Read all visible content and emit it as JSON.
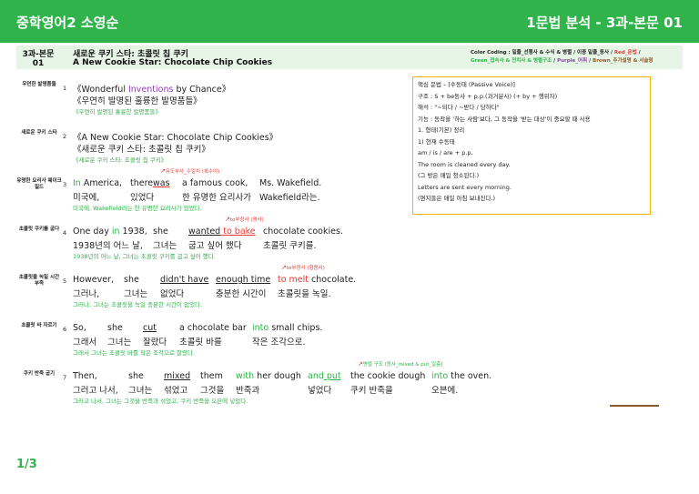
{
  "header": {
    "brand": "중학영어2 소영순",
    "unit": "1문법 분석 - 3과-본문 01"
  },
  "lesson": {
    "code_line1": "3과-본문",
    "code_line2": "01",
    "title_kr": "새로운 쿠키 스타: 초콜릿 칩 쿠키",
    "title_en": "A New Cookie Star: Chocolate Chip Cookies"
  },
  "color_coding": {
    "line1_a": "Color Coding : 밑줄_선행사 & 수식 & 병렬 / 이중 밑줄_동사 / ",
    "line1_red": "Red_문법",
    "line1_b": " /",
    "line2_green": "Green_접속사 & 전치사 & 병렬구조",
    "line2_sep1": " / ",
    "line2_purple": "Purple_어휘",
    "line2_sep2": " / ",
    "line2_brown": "Brown_추가설명 & 서술형"
  },
  "rows": [
    {
      "label": "우연한 발명품들",
      "num": "1",
      "en": "《Wonderful Inventions by Chance》",
      "en_a": "《Wonderful ",
      "en_purple": "Inventions",
      "en_b": " by Chance》",
      "ko": "《우연히 발명된 훌륭한 발명품들》",
      "tr": "《우연히 발명된 훌륭한 발명품들》"
    },
    {
      "label": "새로운 쿠키 스타",
      "num": "2",
      "en": "《A New Cookie Star: Chocolate Chip Cookies》",
      "ko": "《새로운 쿠키 스타: 초콜릿 칩 쿠키》",
      "tr": "《새로운 쿠키 스타: 초콜릿 칩 쿠키》"
    },
    {
      "label": "유명한 요리사 웨이크필드",
      "num": "3",
      "note": "유도부사_수일치 (복수이)",
      "en": [
        "In",
        " America,",
        "there",
        "was",
        "a famous cook,",
        "Ms. Wakefield."
      ],
      "ko": [
        "미국에,",
        "있었다",
        "한 유명한 요리사가",
        "Wakefield라는."
      ],
      "tr": "미국에, Wakefield라는 한 유명한 요리사가 있었다."
    },
    {
      "label": "초콜릿 쿠키를 굽다",
      "num": "4",
      "note": "to부정사 (명사)",
      "en": [
        "One day",
        " in",
        " 1938,",
        "she",
        "wanted",
        " to bake",
        "chocolate cookies."
      ],
      "ko": [
        "1938년의 어느 날,",
        "그녀는",
        "굽고 싶어 했다",
        "초콜릿 쿠키를."
      ],
      "tr": "1938년의 어느 날, 그녀는 초콜릿 쿠키를 굽고 싶어 했다."
    },
    {
      "label": "초콜릿을 녹일 시간 부족",
      "num": "5",
      "note": "to부정사 (형용사)",
      "en": [
        "However,",
        "she",
        "didn't have",
        "enough time",
        "to melt",
        " chocolate."
      ],
      "ko": [
        "그러나,",
        "그녀는",
        "없었다",
        "충분한 시간이",
        "초콜릿을 녹일."
      ],
      "tr": "그러나, 그녀는 초콜릿을 녹일 충분한 시간이 없었다."
    },
    {
      "label": "초콜릿 바 자르기",
      "num": "6",
      "en": [
        "So,",
        "she",
        "cut",
        "a chocolate bar",
        "into",
        " small chips."
      ],
      "ko": [
        "그래서",
        "그녀는",
        "잘랐다",
        "초콜릿 바를",
        "작은 조각으로."
      ],
      "tr": "그래서 그녀는 초콜릿 바를 작은 조각으로 잘랐다."
    },
    {
      "label": "쿠키 반죽 굽기",
      "num": "7",
      "note": "병렬 구조 (동사_mixed & put_일층)",
      "en": [
        "Then,",
        "she",
        "mixed",
        "them",
        "with",
        " her dough",
        "and",
        " put",
        "the cookie dough",
        "into",
        " the oven."
      ],
      "ko": [
        "그러고 나서,",
        "그녀는",
        "섞었고",
        "그것을",
        "반죽과",
        "넣었다",
        "쿠키 반죽을",
        "오븐에."
      ],
      "tr": "그러고 나서, 그녀는 그것을 반죽과 섞었고, 쿠키 반죽을 오븐에 넣었다."
    }
  ],
  "grammar": {
    "title": "핵심 문법 – [수동태 (Passive Voice)]",
    "l1": "구조 : S + be동사 + p.p.(과거분사) (+ by + 행위자)",
    "l2": "해석 : \"~되다 / ~받다 / 당하다\"",
    "l3": "기능 : 동작을 '하는 사람'보다, 그 동작을 '받는 대상'이 중요할 때 사용",
    "l4": "1. 형태(기본) 정리",
    "l5": "1) 현재 수동태",
    "l6": "am / is / are + p.p.",
    "l7": "The room is cleaned every day.",
    "l8": "(그 방은 매일 청소된다.)",
    "l9": "Letters are sent every morning.",
    "l10": "(편지들은 매일 아침 보내진다.)"
  },
  "page": "1/3"
}
